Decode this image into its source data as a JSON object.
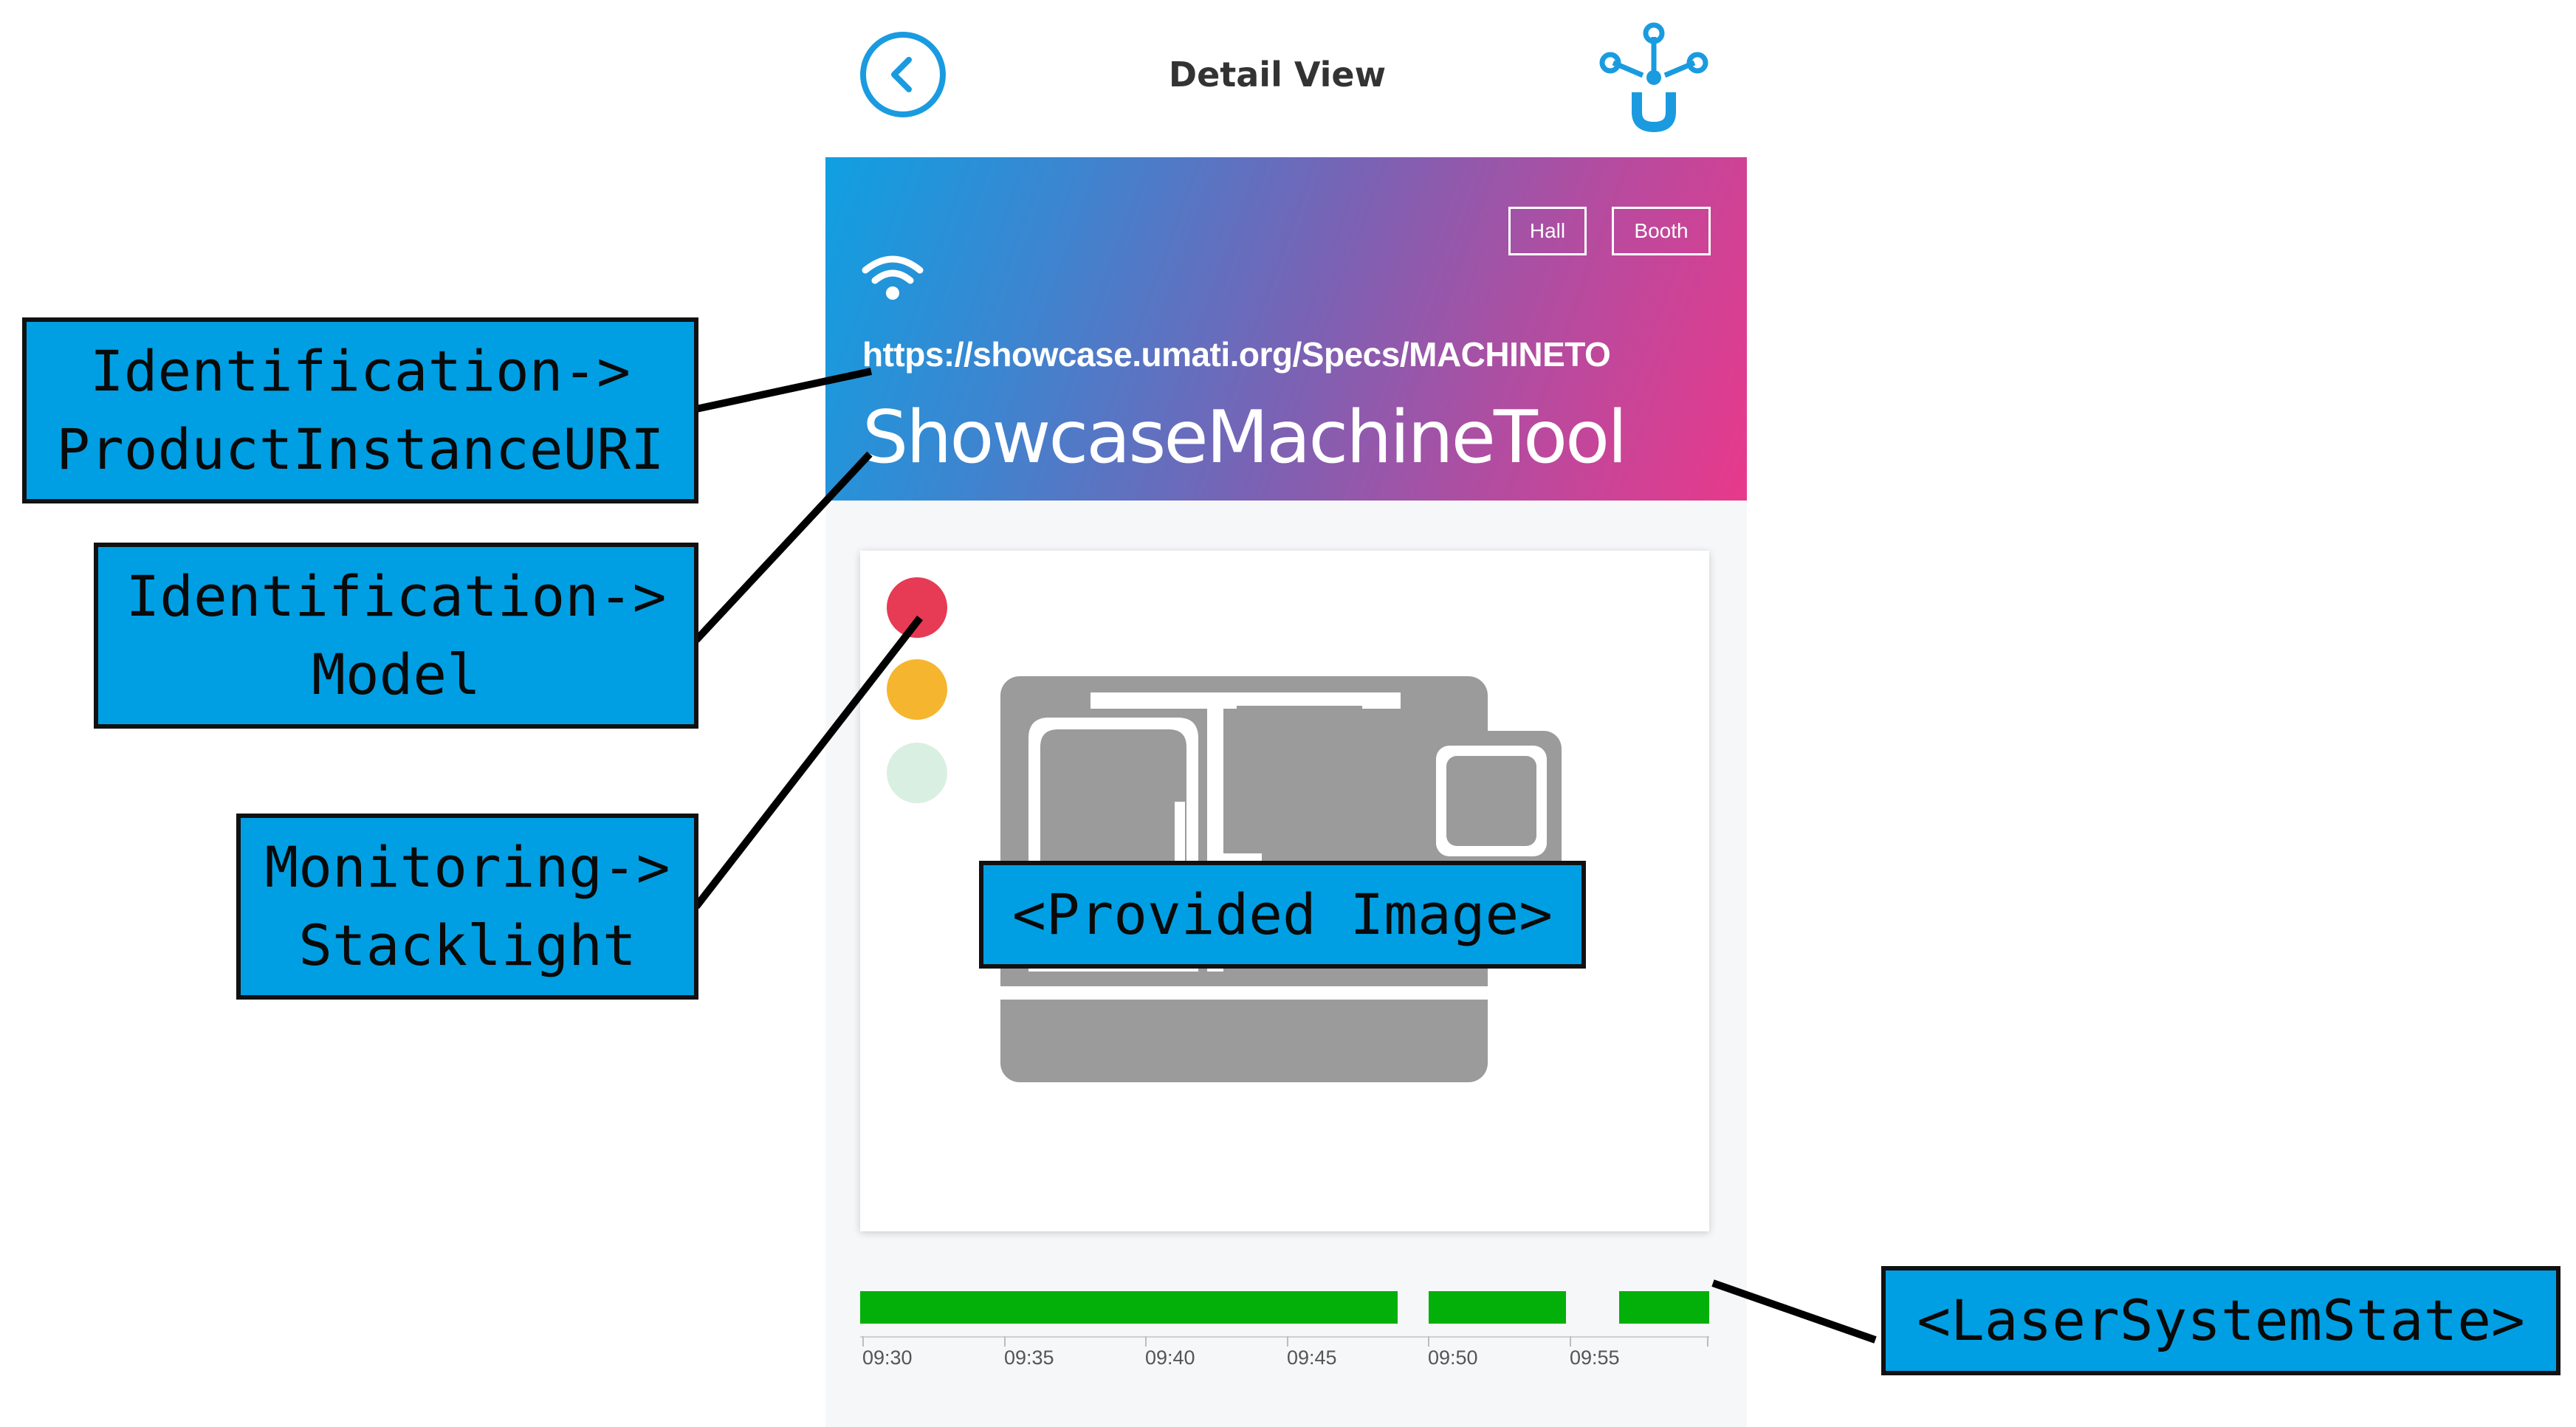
{
  "header": {
    "title": "Detail View",
    "back_icon": "chevron-left-icon",
    "logo_icon": "umati-logo-icon"
  },
  "hero": {
    "tags": [
      "Hall",
      "Booth"
    ],
    "wifi_icon": "wifi-icon",
    "product_instance_uri": "https://showcase.umati.org/Specs/MACHINETO",
    "model": "ShowcaseMachineTool",
    "gradient_colors": [
      "#0fa0e2",
      "#e8398b"
    ]
  },
  "stacklight": {
    "lights": [
      {
        "name": "red",
        "color": "#e63a55",
        "on": true
      },
      {
        "name": "yellow",
        "color": "#f5b52e",
        "on": true
      },
      {
        "name": "green",
        "color": "#d9efe2",
        "on": false
      }
    ]
  },
  "machine_image": {
    "icon": "machine-tool-icon",
    "color": "#9b9b9b"
  },
  "timeline": {
    "state_color": "#03b00a",
    "tick_labels": [
      "09:30",
      "09:35",
      "09:40",
      "09:45",
      "09:50",
      "09:55"
    ],
    "segments": [
      {
        "start": "09:30",
        "end": "09:49"
      },
      {
        "start": "09:50",
        "end": "09:55"
      },
      {
        "start": "09:56:30",
        "end": "09:59:30"
      }
    ]
  },
  "annotations": [
    {
      "lines": [
        "Identification->",
        "ProductInstanceURI"
      ]
    },
    {
      "lines": [
        "Identification->",
        "Model"
      ]
    },
    {
      "lines": [
        "Monitoring->",
        "Stacklight"
      ]
    },
    {
      "lines": [
        "<Provided Image>"
      ]
    },
    {
      "lines": [
        "<LaserSystemState>"
      ]
    }
  ]
}
